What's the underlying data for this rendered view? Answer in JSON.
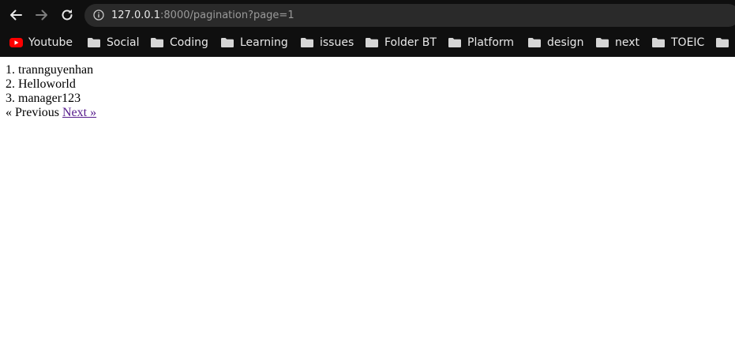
{
  "browser": {
    "url_host": "127.0.0.1",
    "url_rest": ":8000/pagination?page=1",
    "bookmarks": [
      {
        "label": "Youtube",
        "icon": "youtube-icon"
      },
      {
        "label": "Social",
        "icon": "folder-icon"
      },
      {
        "label": "Coding",
        "icon": "folder-icon"
      },
      {
        "label": "Learning",
        "icon": "folder-icon"
      },
      {
        "label": "issues",
        "icon": "folder-icon"
      },
      {
        "label": "Folder BT",
        "icon": "folder-icon"
      },
      {
        "label": "Platform",
        "icon": "folder-icon"
      },
      {
        "label": "design",
        "icon": "folder-icon"
      },
      {
        "label": "next",
        "icon": "folder-icon"
      },
      {
        "label": "TOEIC",
        "icon": "folder-icon"
      },
      {
        "label": "",
        "icon": "folder-icon"
      }
    ]
  },
  "page": {
    "users": [
      "1. trannguyenhan",
      "2. Helloworld",
      "3. manager123"
    ],
    "pager": {
      "previous_label": "« Previous",
      "next_label": "Next »"
    }
  },
  "colors": {
    "chrome_bg": "#0f0f0f",
    "omnibox_bg": "#2a2a2a",
    "link_visited": "#551a8b",
    "youtube_red": "#ff0000"
  }
}
